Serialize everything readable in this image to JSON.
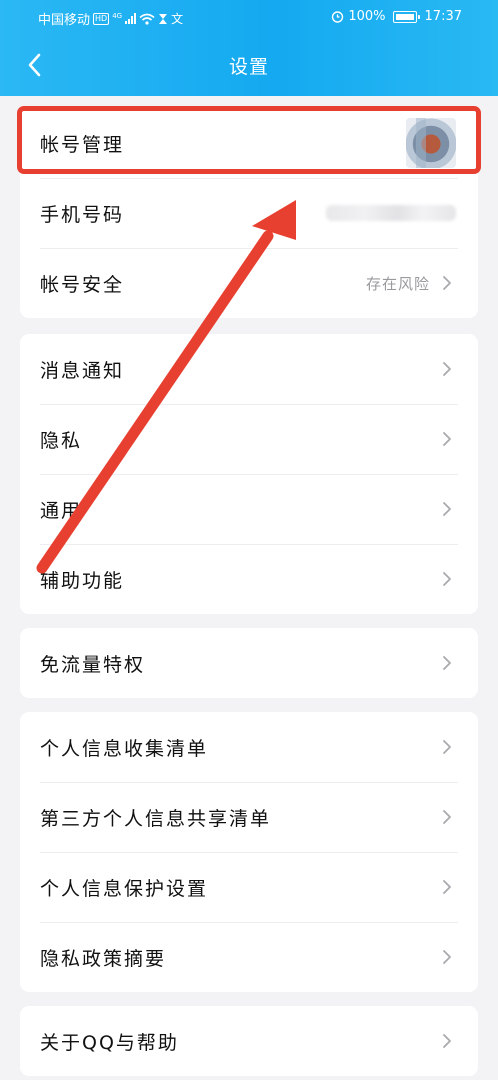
{
  "status_bar": {
    "carrier": "中国移动",
    "hd_badge": "HD",
    "network": "4G",
    "battery": "100%",
    "time": "17:37"
  },
  "header": {
    "title": "设置",
    "back_icon": "chevron-left-icon"
  },
  "colors": {
    "header": "#14a9f0",
    "annotation": "#e84030",
    "background": "#f3f3f6"
  },
  "groups": [
    {
      "items": [
        {
          "label": "帐号管理"
        },
        {
          "label": "手机号码"
        },
        {
          "label": "帐号安全",
          "value": "存在风险"
        }
      ]
    },
    {
      "items": [
        {
          "label": "消息通知"
        },
        {
          "label": "隐私"
        },
        {
          "label": "通用"
        },
        {
          "label": "辅助功能"
        }
      ]
    },
    {
      "items": [
        {
          "label": "免流量特权"
        }
      ]
    },
    {
      "items": [
        {
          "label": "个人信息收集清单"
        },
        {
          "label": "第三方个人信息共享清单"
        },
        {
          "label": "个人信息保护设置"
        },
        {
          "label": "隐私政策摘要"
        }
      ]
    },
    {
      "items": [
        {
          "label": "关于QQ与帮助"
        }
      ]
    }
  ]
}
